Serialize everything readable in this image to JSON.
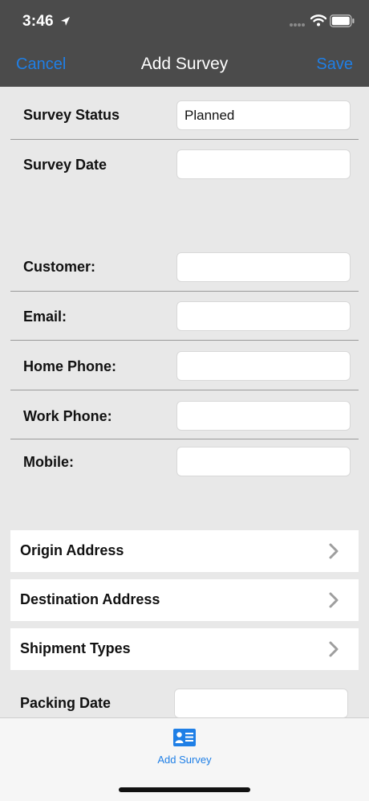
{
  "status_bar": {
    "time": "3:46"
  },
  "nav": {
    "cancel_label": "Cancel",
    "title": "Add Survey",
    "save_label": "Save"
  },
  "form": {
    "survey_status": {
      "label": "Survey Status",
      "value": "Planned"
    },
    "survey_date": {
      "label": "Survey Date",
      "value": ""
    },
    "customer": {
      "label": "Customer:",
      "value": ""
    },
    "email": {
      "label": "Email:",
      "value": ""
    },
    "home_phone": {
      "label": "Home Phone:",
      "value": ""
    },
    "work_phone": {
      "label": "Work Phone:",
      "value": ""
    },
    "mobile": {
      "label": "Mobile:",
      "value": ""
    },
    "packing_date": {
      "label": "Packing Date",
      "value": ""
    }
  },
  "cells": {
    "origin": "Origin Address",
    "destination": "Destination Address",
    "shipment": "Shipment Types"
  },
  "tabbar": {
    "active_label": "Add Survey"
  },
  "colors": {
    "accent": "#1f7fe6",
    "header_bg": "#4b4b4b",
    "page_bg": "#e8e8e8"
  },
  "icons": {
    "location": "location-arrow-icon",
    "signal": "cellular-signal-icon",
    "wifi": "wifi-icon",
    "battery": "battery-icon",
    "chevron": "chevron-right-icon",
    "tab": "contact-card-icon"
  }
}
